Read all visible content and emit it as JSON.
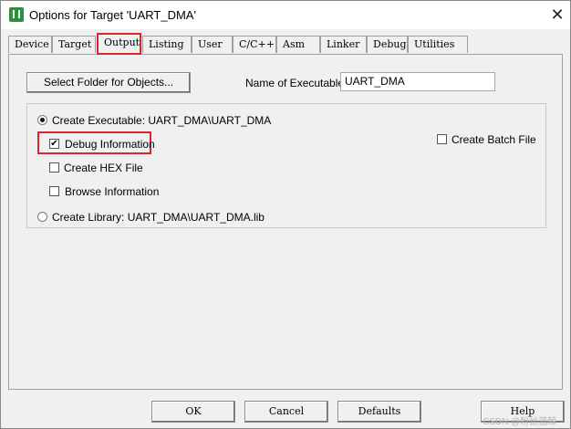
{
  "window": {
    "title": "Options for Target 'UART_DMA'"
  },
  "tabs": [
    {
      "label": "Device"
    },
    {
      "label": "Target"
    },
    {
      "label": "Output"
    },
    {
      "label": "Listing"
    },
    {
      "label": "User"
    },
    {
      "label": "C/C++"
    },
    {
      "label": "Asm"
    },
    {
      "label": "Linker"
    },
    {
      "label": "Debug"
    },
    {
      "label": "Utilities"
    }
  ],
  "active_tab": "Output",
  "output": {
    "select_folder_label": "Select Folder for Objects...",
    "name_exec_label": "Name of Executable:",
    "name_exec_value": "UART_DMA",
    "create_exec_label": "Create Executable:  UART_DMA\\UART_DMA",
    "create_exec_selected": true,
    "debug_info_label": "Debug Information",
    "debug_info_checked": true,
    "create_hex_label": "Create HEX File",
    "create_hex_checked": false,
    "browse_info_label": "Browse Information",
    "browse_info_checked": false,
    "create_batch_label": "Create Batch File",
    "create_batch_checked": false,
    "create_lib_label": "Create Library:  UART_DMA\\UART_DMA.lib",
    "create_lib_selected": false
  },
  "footer": {
    "ok_label": "OK",
    "cancel_label": "Cancel",
    "defaults_label": "Defaults",
    "help_label": "Help"
  },
  "watermark": "CSDN @粉丝蓝鲸",
  "colors": {
    "highlight": "#d9262c",
    "dialog_bg": "#f0f0f0"
  }
}
